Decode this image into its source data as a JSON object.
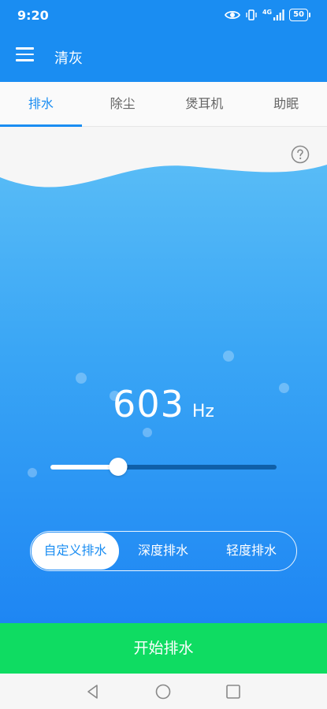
{
  "status": {
    "time": "9:20",
    "network": "4G",
    "battery": "50"
  },
  "appbar": {
    "title": "清灰"
  },
  "tabs": [
    {
      "label": "排水",
      "active": true
    },
    {
      "label": "除尘",
      "active": false
    },
    {
      "label": "煲耳机",
      "active": false
    },
    {
      "label": "助眠",
      "active": false
    }
  ],
  "frequency": {
    "value": "603",
    "unit": "Hz",
    "slider_fraction": 0.3
  },
  "modes": [
    {
      "label": "自定义排水",
      "active": true
    },
    {
      "label": "深度排水",
      "active": false
    },
    {
      "label": "轻度排水",
      "active": false
    }
  ],
  "start_button": "开始排水",
  "icons": {
    "menu": "menu-icon",
    "help": "help-icon",
    "eye": "eye-icon",
    "vibrate": "vibrate-icon",
    "signal": "signal-icon",
    "battery": "battery-icon",
    "back": "back-icon",
    "home": "home-icon",
    "recents": "recents-icon"
  },
  "colors": {
    "primary": "#1a8df2",
    "start_button": "#0fdc62",
    "background": "#f6f6f6"
  }
}
